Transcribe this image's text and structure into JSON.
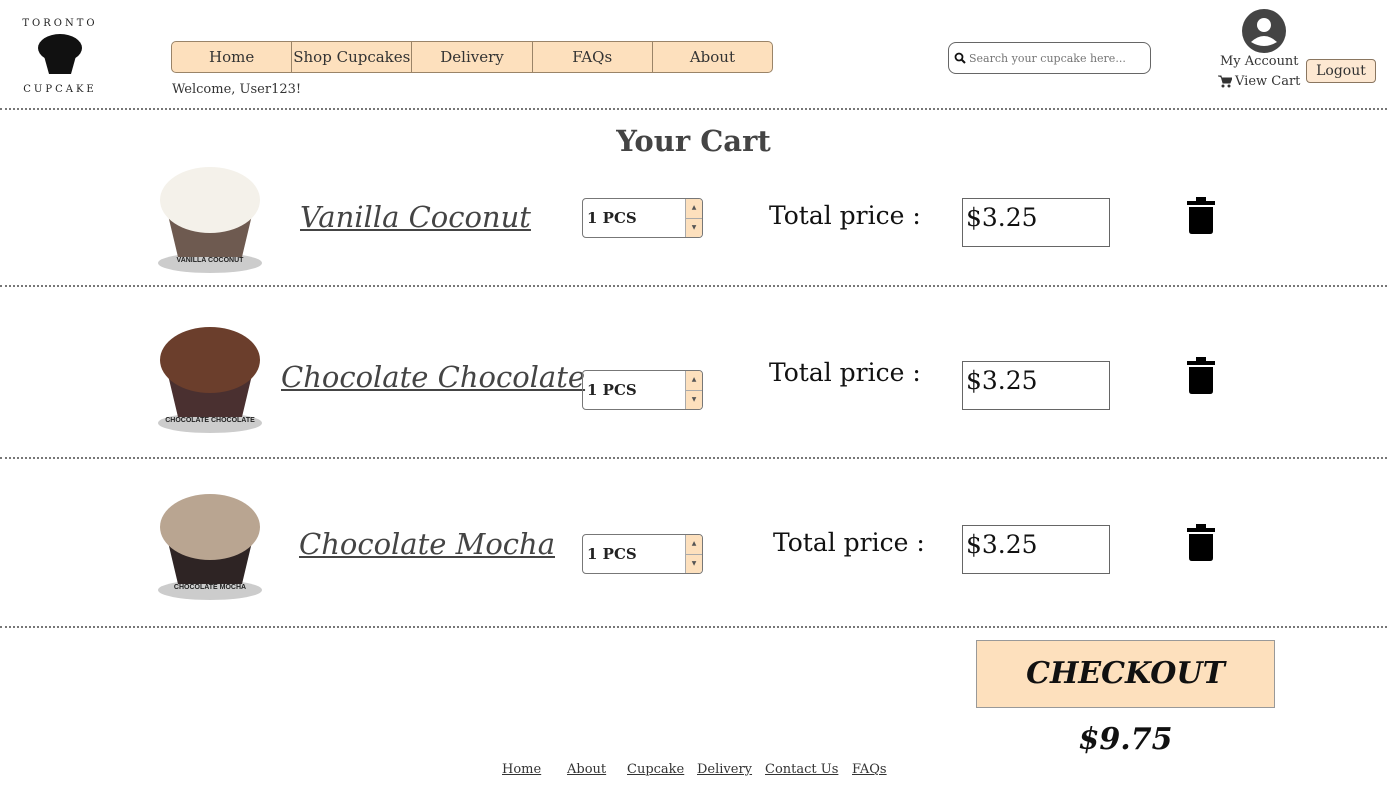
{
  "header": {
    "logo_text": "TORONTO CUPCAKE",
    "nav": [
      "Home",
      "Shop Cupcakes",
      "Delivery",
      "FAQs",
      "About"
    ],
    "welcome": "Welcome, User123!",
    "search_placeholder": "Search your cupcake here...",
    "my_account": "My Account",
    "view_cart": "View Cart",
    "logout": "Logout"
  },
  "cart": {
    "title": "Your Cart",
    "total_label": "Total price :",
    "items": [
      {
        "name": "Vanilla Coconut",
        "image_label": "VANILLA COCONUT",
        "qty": "1 PCS",
        "price": "$3.25",
        "frosting": "#f4f1ea",
        "cake": "#6e5a50"
      },
      {
        "name": "Chocolate Chocolate",
        "image_label": "CHOCOLATE CHOCOLATE",
        "qty": "1 PCS",
        "price": "$3.25",
        "frosting": "#6b3e2c",
        "cake": "#4a3030"
      },
      {
        "name": "Chocolate Mocha",
        "image_label": "CHOCOLATE MOCHA",
        "qty": "1 PCS",
        "price": "$3.25",
        "frosting": "#b9a591",
        "cake": "#2e2424"
      }
    ]
  },
  "checkout": "CHECKOUT $9.75",
  "footer": [
    "Home",
    "About",
    "Cupcake",
    "Delivery",
    "Contact Us",
    "FAQs"
  ],
  "colors": {
    "accent": "#fde0bd"
  }
}
